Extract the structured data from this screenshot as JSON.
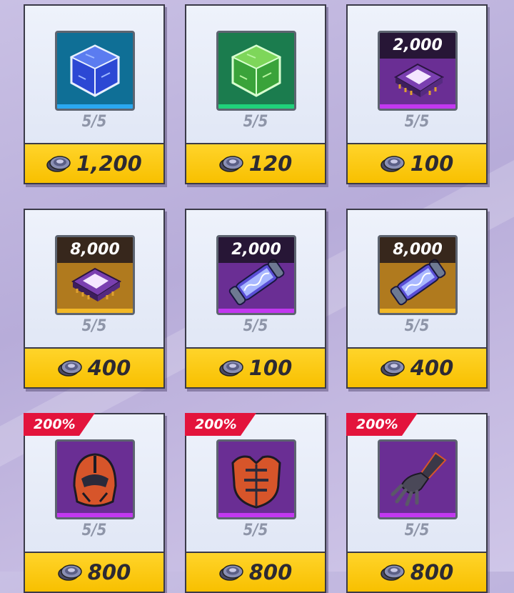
{
  "items": [
    {
      "name": "blue-cube",
      "amount": null,
      "stock": "5/5",
      "price": "1,200",
      "bg": "#0f6f96",
      "bar": "#2aa8f0",
      "badge": null,
      "icon": "blue-cube-icon"
    },
    {
      "name": "green-cube",
      "amount": null,
      "stock": "5/5",
      "price": "120",
      "bg": "#1b7c4e",
      "bar": "#20d27a",
      "badge": null,
      "icon": "green-cube-icon"
    },
    {
      "name": "purple-chip",
      "amount": "2,000",
      "stock": "5/5",
      "price": "100",
      "bg": "#6a2e94",
      "bar": "#c238f0",
      "badge": null,
      "icon": "purple-chip-icon"
    },
    {
      "name": "gold-chip",
      "amount": "8,000",
      "stock": "5/5",
      "price": "400",
      "bg": "#b07a1e",
      "bar": "#f2b827",
      "badge": null,
      "icon": "gold-chip-icon"
    },
    {
      "name": "purple-canister",
      "amount": "2,000",
      "stock": "5/5",
      "price": "100",
      "bg": "#6a2e94",
      "bar": "#c238f0",
      "badge": null,
      "icon": "canister-icon"
    },
    {
      "name": "gold-canister",
      "amount": "8,000",
      "stock": "5/5",
      "price": "400",
      "bg": "#b07a1e",
      "bar": "#f2b827",
      "badge": null,
      "icon": "canister-icon"
    },
    {
      "name": "helmet",
      "amount": null,
      "stock": "5/5",
      "price": "800",
      "bg": "#6a2e94",
      "bar": "#c238f0",
      "badge": "200%",
      "icon": "helmet-icon"
    },
    {
      "name": "chest-armor",
      "amount": null,
      "stock": "5/5",
      "price": "800",
      "bg": "#6a2e94",
      "bar": "#c238f0",
      "badge": "200%",
      "icon": "chest-armor-icon"
    },
    {
      "name": "gauntlet",
      "amount": null,
      "stock": "5/5",
      "price": "800",
      "bg": "#6a2e94",
      "bar": "#c238f0",
      "badge": "200%",
      "icon": "gauntlet-icon"
    }
  ],
  "currency_icon": "coin-icon"
}
